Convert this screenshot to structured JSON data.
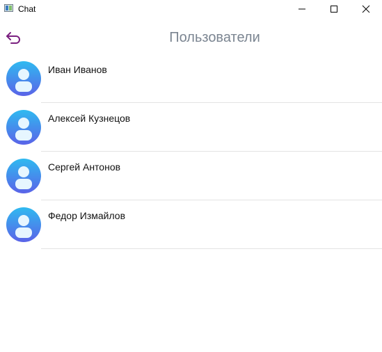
{
  "window": {
    "title": "Chat"
  },
  "header": {
    "title": "Пользователи",
    "back_icon": "back-arrow-icon"
  },
  "users": [
    {
      "name": "Иван Иванов"
    },
    {
      "name": "Алексей Кузнецов"
    },
    {
      "name": "Сергей Антонов"
    },
    {
      "name": "Федор Измайлов"
    }
  ],
  "colors": {
    "accent_back": "#7a1f7f",
    "title_gray": "#7b8591",
    "avatar_gradient_top": "#2fbaf0",
    "avatar_gradient_bottom": "#5a63e8"
  }
}
